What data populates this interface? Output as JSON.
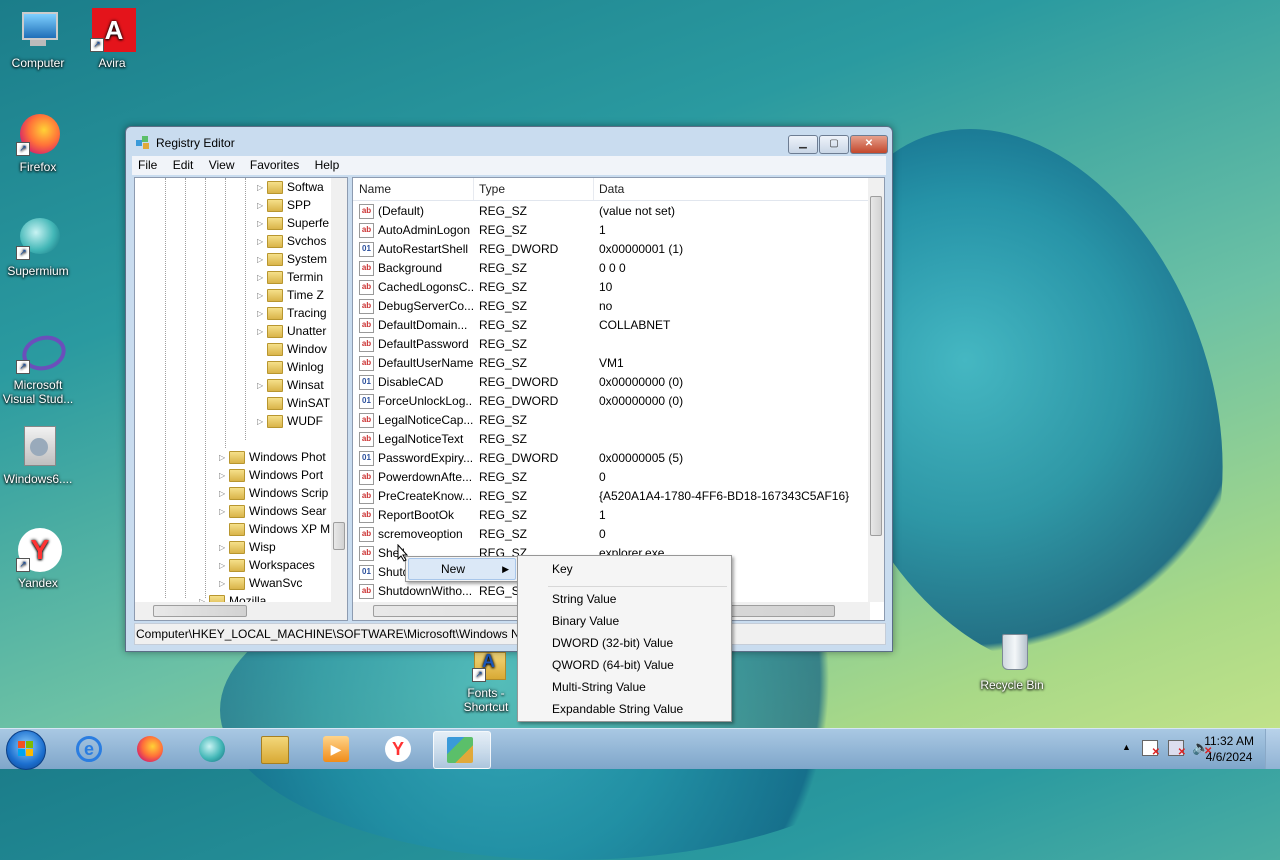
{
  "desktop": {
    "icons": [
      {
        "label": "Computer",
        "icon": "computer-icon"
      },
      {
        "label": "Avira",
        "icon": "avira-icon"
      },
      {
        "label": "Firefox",
        "icon": "firefox-icon"
      },
      {
        "label": "Supermium",
        "icon": "supermium-icon"
      },
      {
        "label": "Microsoft Visual Stud...",
        "icon": "visual-studio-icon"
      },
      {
        "label": "Windows6....",
        "icon": "windows-package-icon"
      },
      {
        "label": "Yandex",
        "icon": "yandex-icon"
      },
      {
        "label": "Fonts - Shortcut",
        "icon": "fonts-folder-icon"
      },
      {
        "label": "Recycle Bin",
        "icon": "recycle-bin-icon"
      }
    ]
  },
  "window": {
    "title": "Registry Editor",
    "controls": {
      "minimize": "▁",
      "maximize": "▢",
      "close": "✕"
    },
    "menu": [
      "File",
      "Edit",
      "View",
      "Favorites",
      "Help"
    ],
    "tree": {
      "items": [
        "Softwa",
        "SPP",
        "Superfe",
        "Svchos",
        "System",
        "Termin",
        "Time Z",
        "Tracing",
        "Unatter",
        "Windov",
        "Winlog",
        "Winsat",
        "WinSAT",
        "WUDF",
        "Windows Phot",
        "Windows Port",
        "Windows Scrip",
        "Windows Sear",
        "Windows XP M",
        "Wisp",
        "Workspaces",
        "WwanSvc",
        "Mozilla"
      ]
    },
    "list": {
      "headers": {
        "name": "Name",
        "type": "Type",
        "data": "Data"
      },
      "rows": [
        {
          "name": "(Default)",
          "type": "REG_SZ",
          "data": "(value not set)",
          "kind": "sz"
        },
        {
          "name": "AutoAdminLogon",
          "type": "REG_SZ",
          "data": "1",
          "kind": "sz"
        },
        {
          "name": "AutoRestartShell",
          "type": "REG_DWORD",
          "data": "0x00000001 (1)",
          "kind": "bin"
        },
        {
          "name": "Background",
          "type": "REG_SZ",
          "data": "0 0 0",
          "kind": "sz"
        },
        {
          "name": "CachedLogonsC...",
          "type": "REG_SZ",
          "data": "10",
          "kind": "sz"
        },
        {
          "name": "DebugServerCo...",
          "type": "REG_SZ",
          "data": "no",
          "kind": "sz"
        },
        {
          "name": "DefaultDomain...",
          "type": "REG_SZ",
          "data": "COLLABNET",
          "kind": "sz"
        },
        {
          "name": "DefaultPassword",
          "type": "REG_SZ",
          "data": "",
          "kind": "sz"
        },
        {
          "name": "DefaultUserName",
          "type": "REG_SZ",
          "data": "VM1",
          "kind": "sz"
        },
        {
          "name": "DisableCAD",
          "type": "REG_DWORD",
          "data": "0x00000000 (0)",
          "kind": "bin"
        },
        {
          "name": "ForceUnlockLog...",
          "type": "REG_DWORD",
          "data": "0x00000000 (0)",
          "kind": "bin"
        },
        {
          "name": "LegalNoticeCap...",
          "type": "REG_SZ",
          "data": "",
          "kind": "sz"
        },
        {
          "name": "LegalNoticeText",
          "type": "REG_SZ",
          "data": "",
          "kind": "sz"
        },
        {
          "name": "PasswordExpiry...",
          "type": "REG_DWORD",
          "data": "0x00000005 (5)",
          "kind": "bin"
        },
        {
          "name": "PowerdownAfte...",
          "type": "REG_SZ",
          "data": "0",
          "kind": "sz"
        },
        {
          "name": "PreCreateKnow...",
          "type": "REG_SZ",
          "data": "{A520A1A4-1780-4FF6-BD18-167343C5AF16}",
          "kind": "sz"
        },
        {
          "name": "ReportBootOk",
          "type": "REG_SZ",
          "data": "1",
          "kind": "sz"
        },
        {
          "name": "scremoveoption",
          "type": "REG_SZ",
          "data": "0",
          "kind": "sz"
        },
        {
          "name": "Shell",
          "type": "REG_SZ",
          "data": "explorer.exe",
          "kind": "sz"
        },
        {
          "name": "Shutd",
          "type": "",
          "data": "",
          "kind": "bin"
        },
        {
          "name": "ShutdownWitho...",
          "type": "REG_SZ",
          "data": "",
          "kind": "sz"
        }
      ]
    },
    "status_path": "Computer\\HKEY_LOCAL_MACHINE\\SOFTWARE\\Microsoft\\Windows NT"
  },
  "context_menu": {
    "parent": "New",
    "items": [
      "Key",
      "String Value",
      "Binary Value",
      "DWORD (32-bit) Value",
      "QWORD (64-bit) Value",
      "Multi-String Value",
      "Expandable String Value"
    ]
  },
  "taskbar": {
    "apps": [
      "internet-explorer-icon",
      "firefox-icon",
      "supermium-icon",
      "file-explorer-icon",
      "media-player-icon",
      "yandex-icon",
      "registry-editor-icon"
    ],
    "time": "11:32 AM",
    "date": "4/6/2024"
  }
}
